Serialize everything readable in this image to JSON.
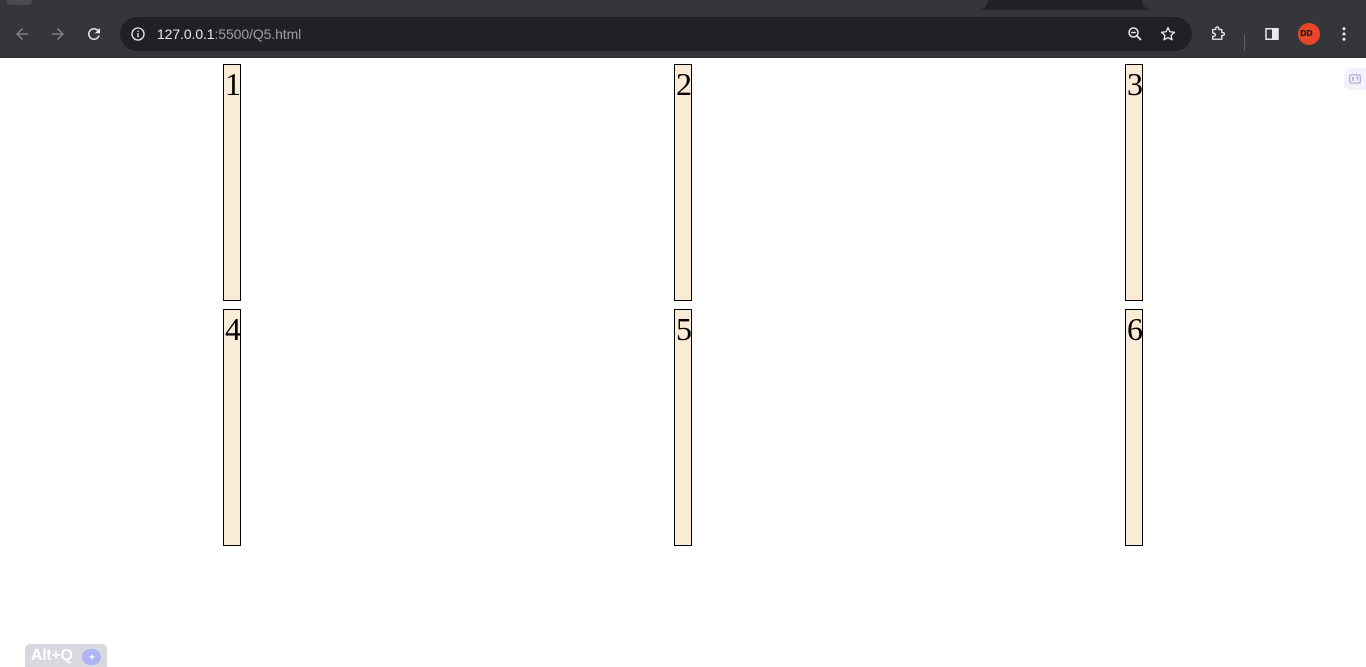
{
  "browser": {
    "url_host": "127.0.0.1",
    "url_path": ":5500/Q5.html",
    "icons": {
      "back": "arrow-left-icon",
      "forward": "arrow-right-icon",
      "reload": "reload-icon",
      "site_info": "info-icon",
      "zoom": "zoom-out-icon",
      "bookmark": "star-icon",
      "extensions": "puzzle-icon",
      "side_panel": "side-panel-icon",
      "menu": "kebab-menu-icon"
    },
    "avatar_text": "DD"
  },
  "page": {
    "boxes": [
      {
        "label": "1"
      },
      {
        "label": "2"
      },
      {
        "label": "3"
      },
      {
        "label": "4"
      },
      {
        "label": "5"
      },
      {
        "label": "6"
      }
    ],
    "box_color": "#faebd7",
    "shortcut_hint": "Alt+Q"
  }
}
